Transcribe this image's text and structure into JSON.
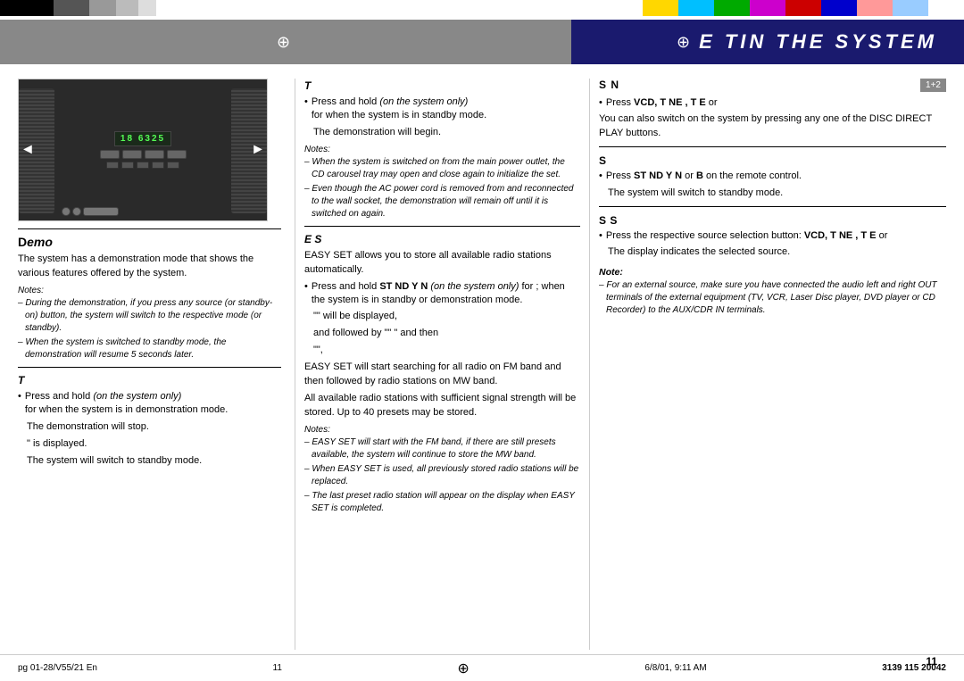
{
  "colorbar": {
    "label": "color registration bar"
  },
  "header": {
    "title": "E  TIN  THE SYSTEM",
    "crosshair_label": "crosshair marker"
  },
  "left_col": {
    "section_label": "/ ",
    "demo_section_title": "D",
    "demo_body": "The system has a demonstration mode that shows the various features offered by the system.",
    "notes_title": "Notes:",
    "note1": "During the demonstration, if you press any source (or standby-on) button, the system will switch to the respective mode (or standby).",
    "note2": "When the system is switched to standby mode, the demonstration will resume 5 seconds later.",
    "turn_on_title": "T",
    "turn_on_bullet": "Press and hold",
    "turn_on_italic": "(on the system only)",
    "turn_on_for": "for",
    "turn_on_when": "when the system is in demonstration mode.",
    "turn_on_stop": "The demonstration will stop.",
    "turn_on_displayed": "\" is displayed.",
    "turn_on_standby": "The system will switch to standby mode."
  },
  "middle_col": {
    "turn_off_title": "T",
    "turn_off_bullet": "Press and hold",
    "turn_off_italic": "(on the system only)",
    "turn_off_for": "for",
    "turn_off_when": "when the system is in standby mode.",
    "turn_off_begin": "The demonstration will begin.",
    "easy_set_title": "E     S",
    "easy_set_body": "EASY SET allows you to store all available radio stations automatically.",
    "easy_set_bullet": "Press and hold",
    "easy_set_bold": "ST  ND Y  N",
    "easy_set_italic": "(on the system only)",
    "easy_set_for": "for",
    "easy_set_semi": "; when the system is in standby or demonstration mode.",
    "easy_set_will": "\" will be displayed,",
    "easy_set_then": "and followed by \"",
    "easy_set_and": "\" and then",
    "easy_set_quote": "\"",
    "easy_set_comma": "\",",
    "easy_set_search": "EASY SET will start searching for all radio on FM band and then followed by radio stations on MW band.",
    "easy_set_all": "All available radio stations with sufficient signal strength will be stored. Up to 40 presets may be stored.",
    "notes_title": "Notes:",
    "note1": "When the system is switched on from the main power outlet, the CD carousel tray may open and close again to initialize the set.",
    "note2": "Even though the AC power cord is removed from and reconnected to the wall socket, the demonstration will remain off until it is switched on again.",
    "easy_notes_title": "Notes:",
    "easy_note1": "EASY SET will start with the FM band, if there are still presets available, the system will continue to store the MW band.",
    "easy_note2": "When EASY SET is used, all previously stored radio stations will be replaced.",
    "easy_note3": "The last preset radio station will appear on the display when EASY SET is completed."
  },
  "right_col": {
    "switching_title": "S       N",
    "switch_bullet": "Press",
    "switch_bold": "VCD, T  NE , T  E",
    "switch_or": "or",
    "switch_body": "You can also switch on the system by pressing any one of the DISC DIRECT PLAY buttons.",
    "badge": "1+2",
    "standby_title": "S",
    "standby_bullet": "Press",
    "standby_bold": "ST  ND Y  N",
    "standby_or": "or",
    "standby_B": "B",
    "standby_on": "on the remote control.",
    "standby_result": "The system will switch to standby mode.",
    "source_title": "S       S",
    "source_bullet": "Press the respective source selection button:",
    "source_bold": "VCD, T  NE , T  E",
    "source_or": "or",
    "source_result": "The display indicates the selected source.",
    "note_label": "Note:",
    "note_italic1": "For an external source, make sure you have connected the audio left and right OUT terminals of the external equipment (TV, VCR, Laser Disc player, DVD player or CD Recorder) to the AUX/CDR IN terminals."
  },
  "footer": {
    "left": "pg 01-28/V55/21 En",
    "page_num_left": "11",
    "date": "6/8/01, 9:11 AM",
    "product_code": "3139 115 20042",
    "page_num": "11"
  }
}
